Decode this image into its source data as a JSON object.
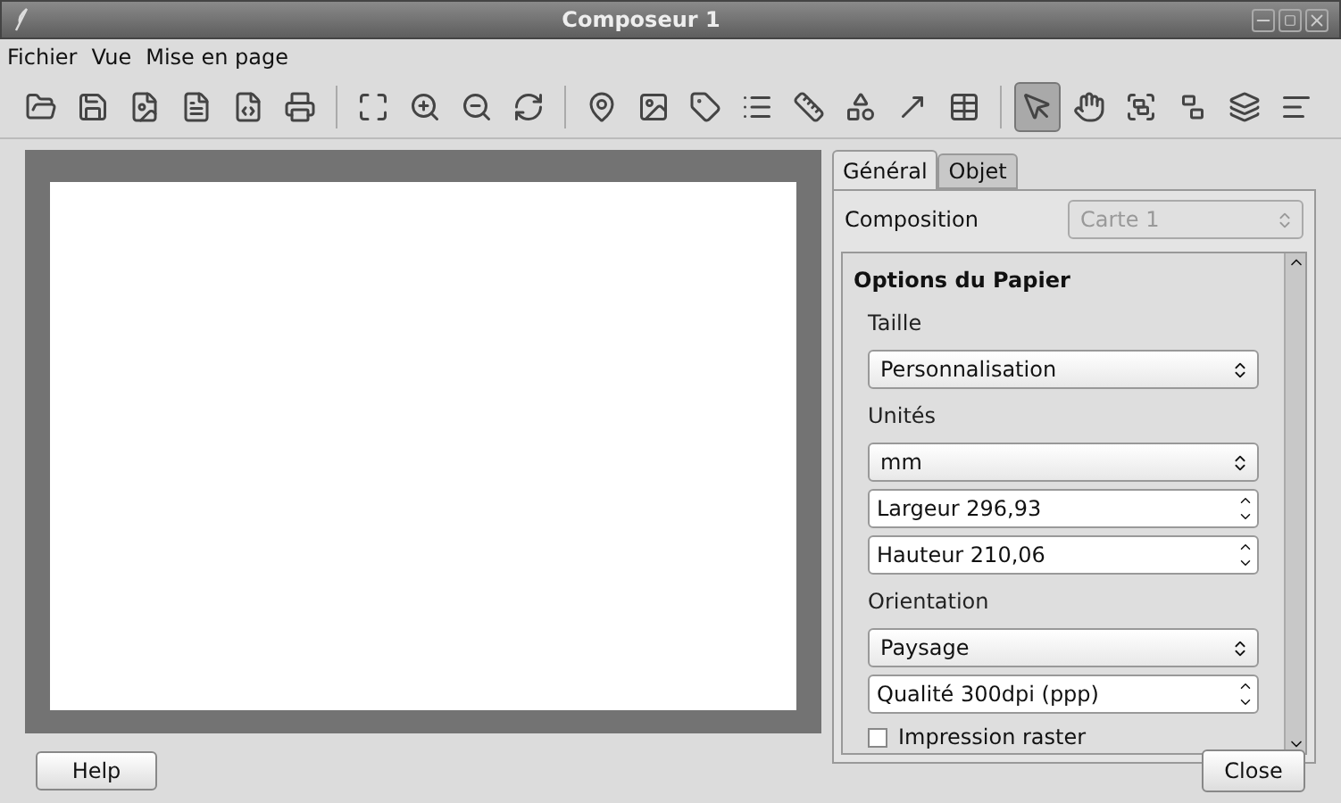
{
  "window": {
    "title": "Composeur 1"
  },
  "menu": [
    "Fichier",
    "Vue",
    "Mise en page"
  ],
  "toolbar": [
    [
      {
        "selected": false
      },
      {
        "selected": false
      },
      {
        "selected": false
      },
      {
        "selected": false
      },
      {
        "selected": false
      },
      {
        "selected": false
      }
    ],
    [
      {
        "selected": false
      },
      {
        "selected": false
      },
      {
        "selected": false
      },
      {
        "selected": false
      }
    ],
    [
      {
        "selected": false
      },
      {
        "selected": false
      },
      {
        "selected": false
      },
      {
        "selected": false
      },
      {
        "selected": false
      },
      {
        "selected": false
      },
      {
        "selected": false
      },
      {
        "selected": false
      }
    ],
    [
      {
        "selected": true
      },
      {
        "selected": false
      },
      {
        "selected": false
      },
      {
        "selected": false
      },
      {
        "selected": false
      },
      {
        "selected": false
      }
    ]
  ],
  "tabs": [
    {
      "label": "Général",
      "selected": true
    },
    {
      "label": "Objet",
      "selected": false
    }
  ],
  "composition": {
    "label": "Composition",
    "value": "Carte 1",
    "disabled": true
  },
  "paper": {
    "title": "Options du Papier",
    "fields": [
      {
        "kind": "label",
        "text": "Taille"
      },
      {
        "kind": "select",
        "text": "Personnalisation"
      },
      {
        "kind": "label",
        "text": "Unités"
      },
      {
        "kind": "select",
        "text": "mm"
      },
      {
        "kind": "spin",
        "text": "Largeur 296,93"
      },
      {
        "kind": "spin",
        "text": "Hauteur 210,06"
      },
      {
        "kind": "label",
        "text": "Orientation"
      },
      {
        "kind": "select",
        "text": "Paysage"
      },
      {
        "kind": "spin",
        "text": "Qualité 300dpi (ppp)"
      },
      {
        "kind": "check",
        "text": "Impression raster",
        "checked": false
      }
    ]
  },
  "buttons": {
    "help": "Help",
    "close": "Close"
  }
}
